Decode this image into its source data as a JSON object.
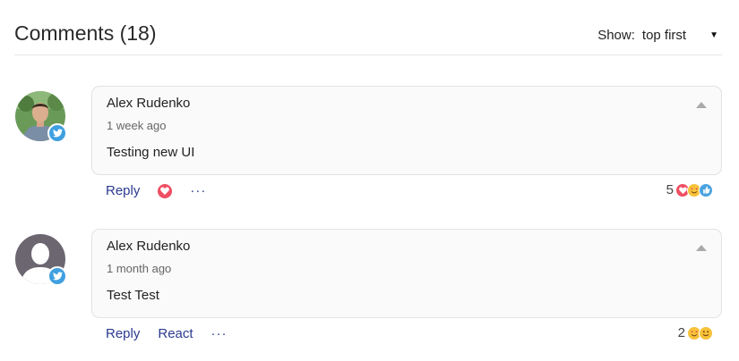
{
  "header": {
    "title": "Comments (18)",
    "sort_label": "Show:",
    "sort_value": "top first"
  },
  "comments": [
    {
      "author": "Alex Rudenko",
      "time": "1 week ago",
      "text": "Testing new UI",
      "actions": {
        "reply": "Reply",
        "more": "···"
      },
      "reaction_count": "5",
      "reaction_icons": [
        "heart-icon",
        "heart-eyes-icon",
        "thumbs-up-icon"
      ]
    },
    {
      "author": "Alex Rudenko",
      "time": "1 month ago",
      "text": "Test Test",
      "actions": {
        "reply": "Reply",
        "react": "React",
        "more": "···"
      },
      "reaction_count": "2",
      "reaction_icons": [
        "heart-eyes-icon",
        "smile-icon"
      ]
    }
  ],
  "colors": {
    "link": "#2b3a8f",
    "twitter": "#3fa0e0",
    "heart": "#ef4f63",
    "emoji": "#f7c23a",
    "like": "#4aa3df"
  }
}
